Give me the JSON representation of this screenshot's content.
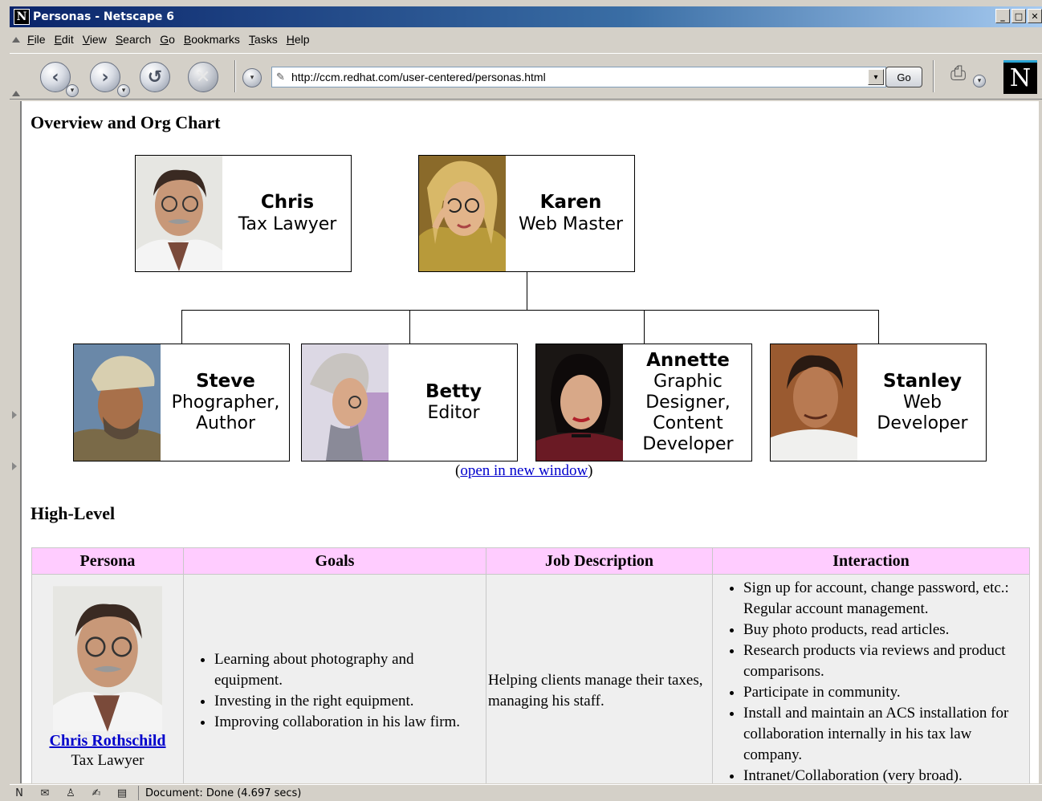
{
  "window": {
    "title": "Personas - Netscape 6",
    "app_icon": "N"
  },
  "menu": [
    "File",
    "Edit",
    "View",
    "Search",
    "Go",
    "Bookmarks",
    "Tasks",
    "Help"
  ],
  "nav": {
    "url": "http://ccm.redhat.com/user-centered/personas.html",
    "go_label": "Go",
    "logo": "N"
  },
  "page": {
    "overview_heading": "Overview and Org Chart",
    "open_link": "open in new window",
    "open_paren_l": "(",
    "open_paren_r": ")",
    "high_level_heading": "High-Level",
    "org": {
      "top": [
        {
          "name": "Chris",
          "role": [
            "Tax Lawyer"
          ]
        },
        {
          "name": "Karen",
          "role": [
            "Web Master"
          ]
        }
      ],
      "bottom": [
        {
          "name": "Steve",
          "role": [
            "Phographer,",
            "Author"
          ]
        },
        {
          "name": "Betty",
          "role": [
            "Editor"
          ]
        },
        {
          "name": "Annette",
          "role": [
            "Graphic",
            "Designer,",
            "Content",
            "Developer"
          ]
        },
        {
          "name": "Stanley",
          "role": [
            "Web Developer"
          ]
        }
      ]
    },
    "table": {
      "headers": [
        "Persona",
        "Goals",
        "Job Description",
        "Interaction"
      ],
      "rows": [
        {
          "persona_name": "Chris Rothschild",
          "persona_role": "Tax Lawyer",
          "goals": [
            "Learning about photography and equipment.",
            "Investing in the right equipment.",
            "Improving collaboration in his law firm."
          ],
          "job": "Helping clients manage their taxes, managing his staff.",
          "interaction": [
            "Sign up for account, change password, etc.: Regular account management.",
            "Buy photo products, read articles.",
            "Research products via reviews and product comparisons.",
            "Participate in community.",
            "Install and maintain an ACS installation for collaboration internally in his tax law company.",
            "Intranet/Collaboration (very broad)."
          ]
        }
      ]
    }
  },
  "status": {
    "text": "Document: Done (4.697 secs)"
  }
}
